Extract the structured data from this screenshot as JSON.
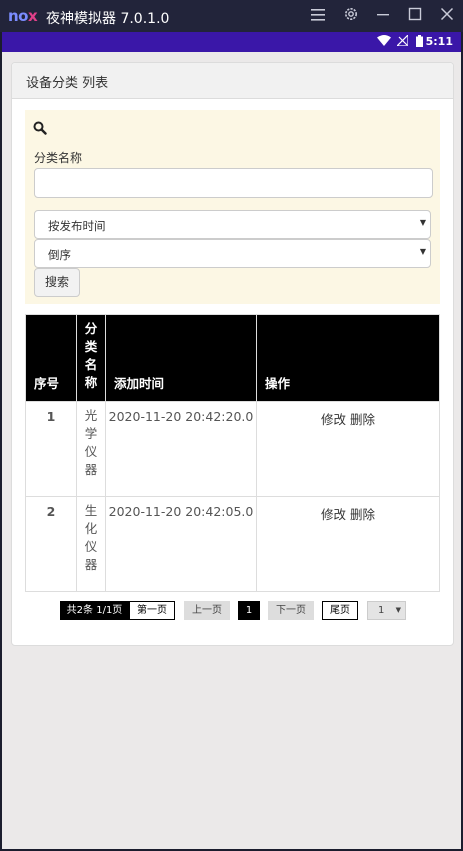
{
  "window": {
    "app_title": "夜神模拟器 7.0.1.0",
    "logo_text_n": "no",
    "logo_text_x": "x"
  },
  "status": {
    "time": "5:11"
  },
  "panel": {
    "title": "设备分类 列表"
  },
  "search": {
    "field_label": "分类名称",
    "name_value": "",
    "sort_select": "按发布时间",
    "order_select": "倒序",
    "button": "搜索"
  },
  "table": {
    "headers": [
      "序号",
      "分类名称",
      "添加时间",
      "操作"
    ],
    "rows": [
      {
        "index": "1",
        "name": "光学仪器",
        "added": "2020-11-20 20:42:20.0",
        "edit": "修改",
        "delete": "删除"
      },
      {
        "index": "2",
        "name": "生化仪器",
        "added": "2020-11-20 20:42:05.0",
        "edit": "修改",
        "delete": "删除"
      }
    ]
  },
  "pagination": {
    "summary": "共2条 1/1页",
    "first": "第一页",
    "prev": "上一页",
    "current": "1",
    "next": "下一页",
    "last": "尾页",
    "jump_select": "1"
  },
  "colors": {
    "titlebar": "#22243a",
    "statusbar": "#3a17a8",
    "search_box": "#fcf7e4",
    "table_header": "#000000"
  }
}
